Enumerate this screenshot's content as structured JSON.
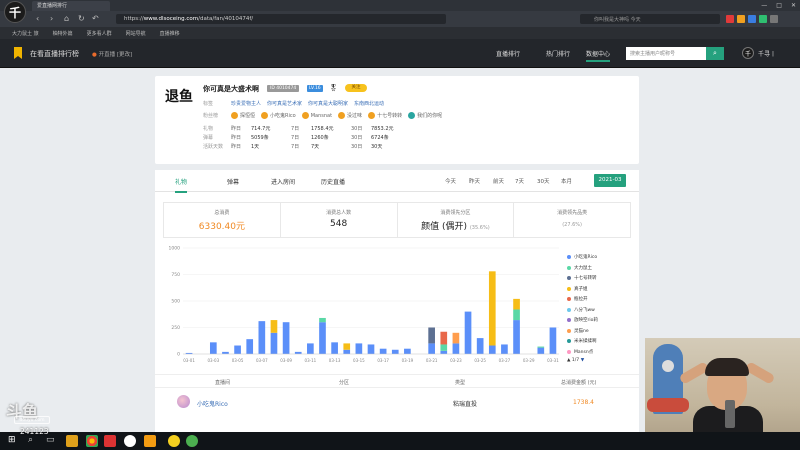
{
  "browser": {
    "tab_title": "爱直播网排行",
    "url_prefix": "https://",
    "url_domain": "www.dlsoceing.com",
    "url_path": "/data/fan/4010474f/",
    "omnibox_search": "你叫我是大神吗 今天",
    "bookmarks": [
      "大力鼠土 旅",
      "柚特外篇",
      "更多看人群",
      "网站导航",
      "直播推移"
    ]
  },
  "site": {
    "name": "在看直播排行榜",
    "location_label": "开直播",
    "location_value": "[更改]",
    "nav": [
      "直播排行",
      "热门排行",
      "数据中心"
    ],
    "search_placeholder": "搜索主播用户昵称号",
    "user_name": "千寻丨"
  },
  "profile": {
    "logo_text": "退鱼",
    "name": "你可真是大盛术啊",
    "id": "ID 4010474",
    "level": "LV.16",
    "medal": "🎖",
    "badge": "关注",
    "tags_label": "标签",
    "tags": [
      "珍贵爱物主人",
      "你可真是艺术家",
      "你可真是大聪明家",
      "东南西北运动"
    ],
    "fans_label": "粉丝榜",
    "fans": [
      {
        "name": "探恒恒",
        "color": "#f0a020"
      },
      {
        "name": "小吃鬼Rico",
        "color": "#f0a020"
      },
      {
        "name": "Mansnat",
        "color": "#f0a020"
      },
      {
        "name": "没过味",
        "color": "#f0a020"
      },
      {
        "name": "十七号转转",
        "color": "#f0a020"
      },
      {
        "name": "我们的你呢",
        "color": "#2aa5a0"
      }
    ],
    "rows": [
      {
        "label": "礼物",
        "p1": "昨日",
        "v1": "714.7元",
        "p2": "7日",
        "v2": "1758.4元",
        "p3": "30日",
        "v3": "7853.2元"
      },
      {
        "label": "弹幕",
        "p1": "昨日",
        "v1": "5059条",
        "p2": "7日",
        "v2": "1260条",
        "p3": "30日",
        "v3": "6724条"
      },
      {
        "label": "活跃天数",
        "p1": "昨日",
        "v1": "1天",
        "p2": "7日",
        "v2": "7天",
        "p3": "30日",
        "v3": "30天"
      }
    ]
  },
  "tabs": [
    "礼物",
    "弹幕",
    "进入房间",
    "历史直播"
  ],
  "ranges": [
    "今天",
    "昨天",
    "前天",
    "7天",
    "30天",
    "本月",
    "更多日期"
  ],
  "range_active": "2021-03",
  "stats": [
    {
      "label": "总消费",
      "value": "6330.40元",
      "highlight": true,
      "sub": ""
    },
    {
      "label": "消费总人数",
      "value": "548",
      "highlight": false,
      "sub": ""
    },
    {
      "label": "消费领先分区",
      "value": "颜值 (偶开)",
      "highlight": false,
      "sub": "(35.6%)"
    },
    {
      "label": "消费领先品类",
      "value": "",
      "highlight": false,
      "sub": "(27.6%)"
    }
  ],
  "chart_data": {
    "type": "bar",
    "stacked": true,
    "ylim": [
      0,
      1000
    ],
    "yticks": [
      0,
      250,
      500,
      750,
      1000
    ],
    "categories": [
      "03-01",
      "03-02",
      "03-03",
      "03-04",
      "03-05",
      "03-06",
      "03-07",
      "03-08",
      "03-09",
      "03-10",
      "03-11",
      "03-12",
      "03-13",
      "03-14",
      "03-15",
      "03-16",
      "03-17",
      "03-18",
      "03-19",
      "03-20",
      "03-21",
      "03-22",
      "03-23",
      "03-24",
      "03-25",
      "03-26",
      "03-27",
      "03-28",
      "03-29",
      "03-30",
      "03-31"
    ],
    "xtick_labels": [
      "03-01",
      "03-03",
      "03-05",
      "03-07",
      "03-09",
      "03-11",
      "03-13",
      "03-15",
      "03-17",
      "03-19",
      "03-21",
      "03-23",
      "03-25",
      "03-27",
      "03-29",
      "03-31"
    ],
    "series": [
      {
        "name": "小吃鬼Rico",
        "color": "#5b8ff9",
        "values": [
          10,
          0,
          110,
          20,
          80,
          140,
          310,
          200,
          300,
          20,
          100,
          300,
          110,
          40,
          100,
          90,
          50,
          40,
          50,
          0,
          100,
          30,
          100,
          400,
          150,
          80,
          90,
          320,
          0,
          60,
          250
        ]
      },
      {
        "name": "大力鼠土",
        "color": "#5ad8a6",
        "values": [
          0,
          0,
          0,
          0,
          0,
          0,
          0,
          0,
          0,
          0,
          0,
          40,
          0,
          0,
          0,
          0,
          0,
          0,
          0,
          0,
          0,
          60,
          0,
          0,
          0,
          0,
          0,
          100,
          0,
          10,
          0
        ]
      },
      {
        "name": "十七号转转",
        "color": "#5d7092",
        "values": [
          0,
          0,
          0,
          0,
          0,
          0,
          0,
          0,
          0,
          0,
          0,
          0,
          0,
          0,
          0,
          0,
          0,
          0,
          0,
          0,
          150,
          0,
          0,
          0,
          0,
          0,
          0,
          0,
          0,
          0,
          0
        ]
      },
      {
        "name": "真子姐",
        "color": "#f6bd16",
        "values": [
          0,
          0,
          0,
          0,
          0,
          0,
          0,
          120,
          0,
          0,
          0,
          0,
          0,
          60,
          0,
          0,
          0,
          0,
          0,
          0,
          0,
          0,
          0,
          0,
          0,
          700,
          0,
          100,
          0,
          0,
          0
        ]
      },
      {
        "name": "瓶拉开",
        "color": "#e8684a",
        "values": [
          0,
          0,
          0,
          0,
          0,
          0,
          0,
          0,
          0,
          0,
          0,
          0,
          0,
          0,
          0,
          0,
          0,
          0,
          0,
          0,
          0,
          120,
          0,
          0,
          0,
          0,
          0,
          0,
          0,
          0,
          0
        ]
      },
      {
        "name": "八分飞ww",
        "color": "#6dc8ec",
        "values": [
          0,
          0,
          0,
          0,
          0,
          0,
          0,
          0,
          0,
          0,
          0,
          0,
          0,
          0,
          0,
          0,
          0,
          0,
          0,
          0,
          0,
          0,
          0,
          0,
          0,
          0,
          0,
          0,
          0,
          0,
          0
        ]
      },
      {
        "name": "放映空rio莉",
        "color": "#9270ca",
        "values": [
          0,
          0,
          0,
          0,
          0,
          0,
          0,
          0,
          0,
          0,
          0,
          0,
          0,
          0,
          0,
          0,
          0,
          0,
          0,
          0,
          0,
          0,
          0,
          0,
          0,
          0,
          0,
          0,
          0,
          0,
          0
        ]
      },
      {
        "name": "灵猫ne",
        "color": "#ff9d4d",
        "values": [
          0,
          0,
          0,
          0,
          0,
          0,
          0,
          0,
          0,
          0,
          0,
          0,
          0,
          0,
          0,
          0,
          0,
          0,
          0,
          0,
          0,
          0,
          100,
          0,
          0,
          0,
          0,
          0,
          0,
          0,
          0
        ]
      },
      {
        "name": "米米揉揉啊",
        "color": "#269a99",
        "values": [
          0,
          0,
          0,
          0,
          0,
          0,
          0,
          0,
          0,
          0,
          0,
          0,
          0,
          0,
          0,
          0,
          0,
          0,
          0,
          0,
          0,
          0,
          0,
          0,
          0,
          0,
          0,
          0,
          0,
          0,
          0
        ]
      },
      {
        "name": "Mansn点",
        "color": "#ff99c3",
        "values": [
          0,
          0,
          0,
          0,
          0,
          0,
          0,
          0,
          0,
          0,
          0,
          0,
          0,
          0,
          0,
          0,
          0,
          0,
          0,
          0,
          0,
          0,
          0,
          0,
          0,
          0,
          0,
          0,
          0,
          0,
          0
        ]
      }
    ],
    "legend_pager": "1/7"
  },
  "table": {
    "headers": [
      "直播间",
      "分区",
      "类型",
      "总消费金额 (元)"
    ],
    "rows": [
      {
        "name": "小吃鬼Rico",
        "category": "",
        "type": "粘瑞直投",
        "amount": "1738.4"
      }
    ]
  },
  "overlay": {
    "watermark": "斗鱼",
    "watermark_sub": "douyu.com",
    "room_no": "241123"
  },
  "colors": {
    "accent": "#25a17e",
    "orange": "#f08a24"
  }
}
